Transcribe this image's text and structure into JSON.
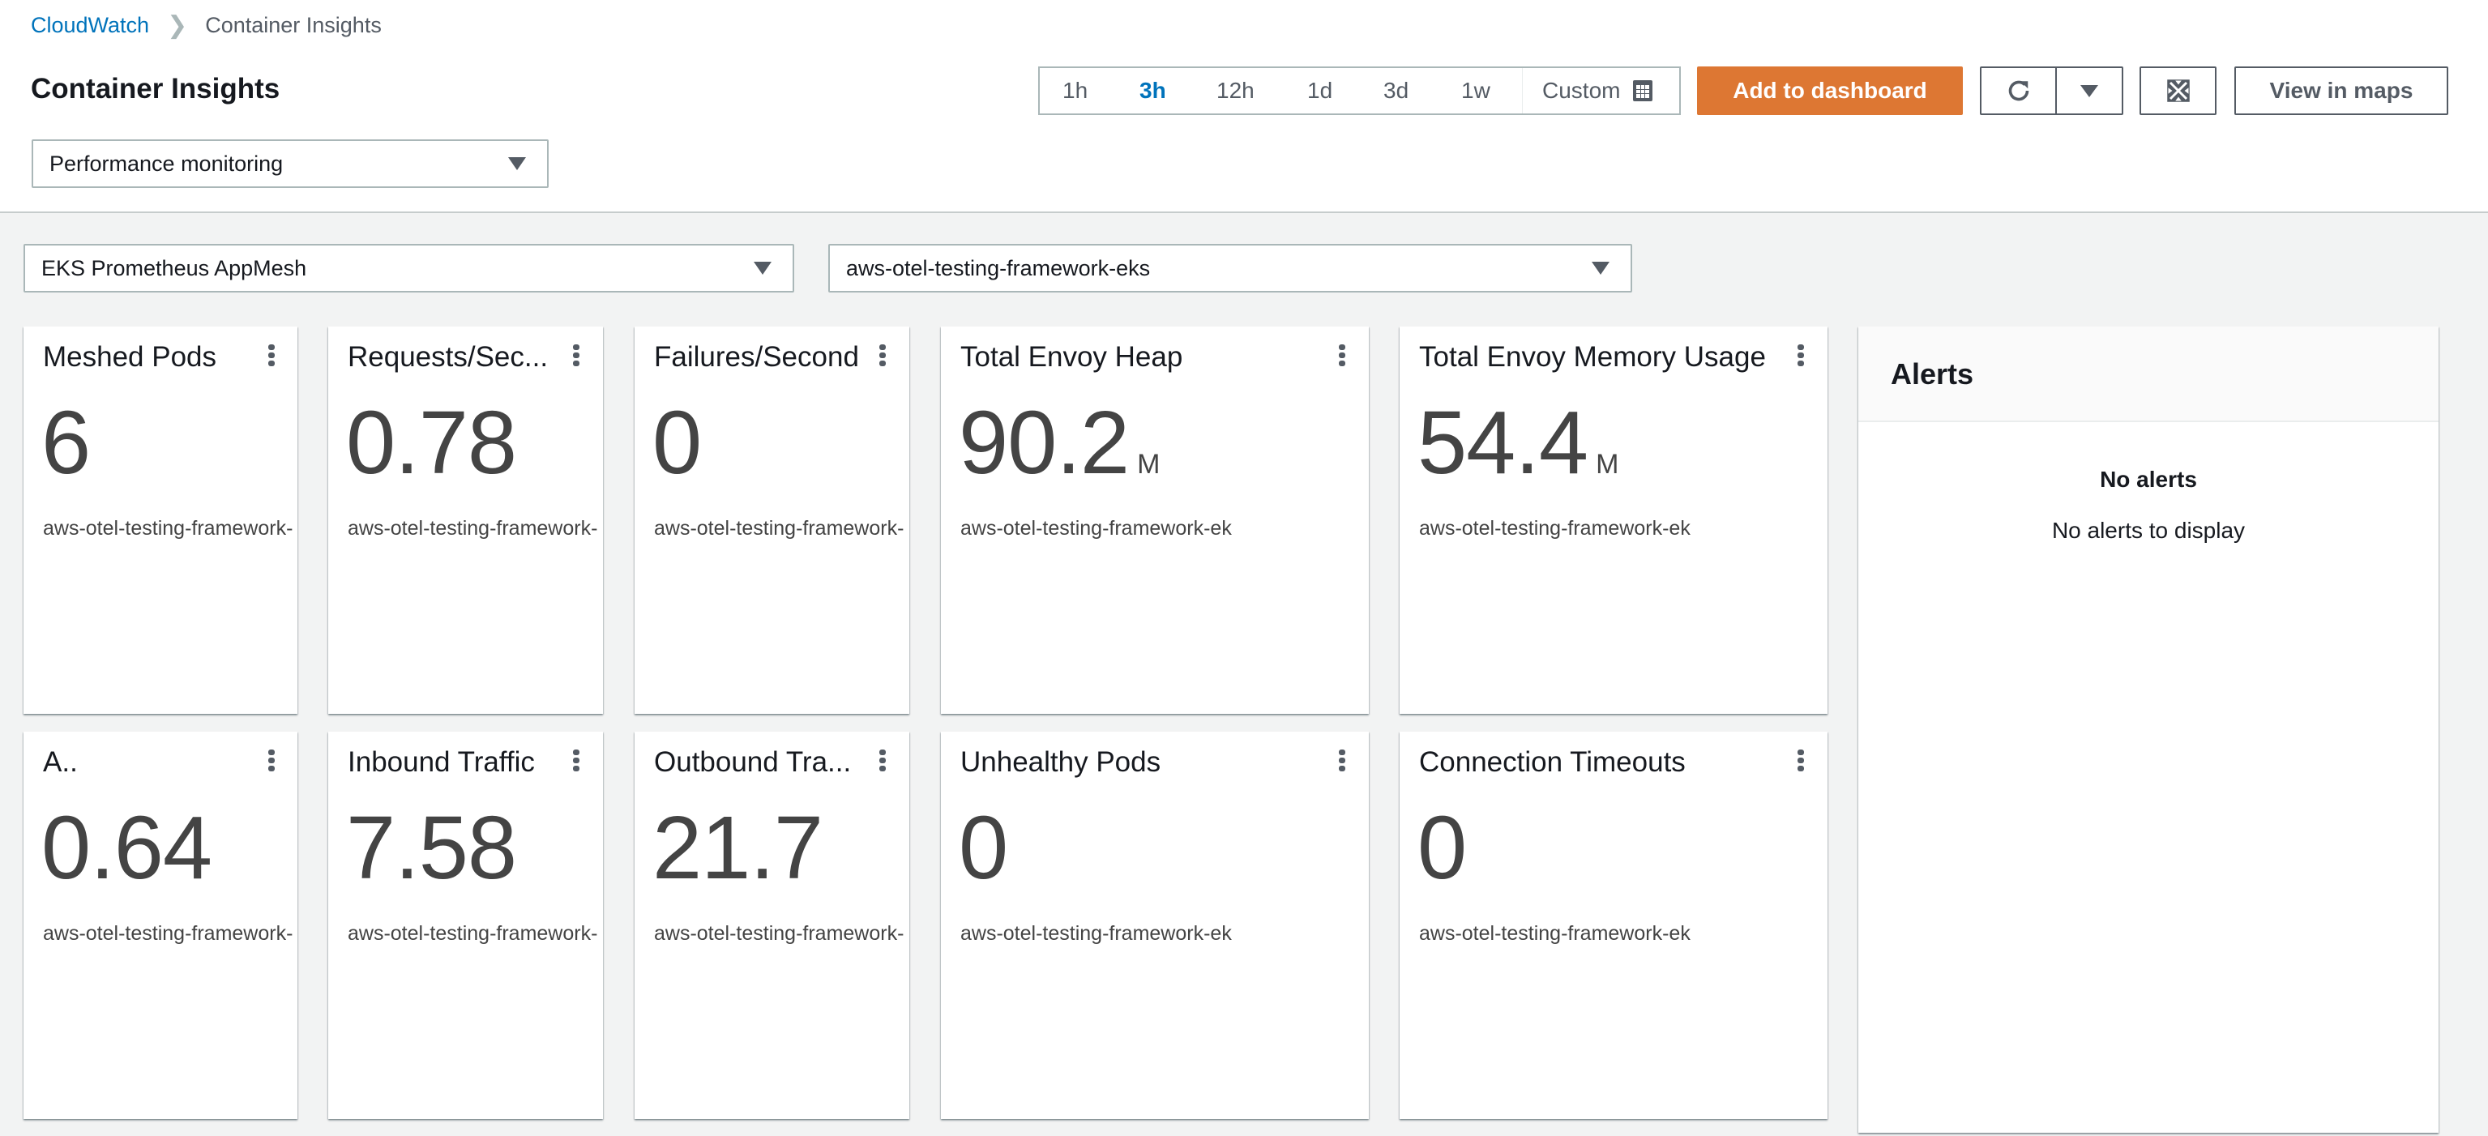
{
  "breadcrumb": {
    "items": [
      {
        "label": "CloudWatch",
        "link": true
      },
      {
        "label": "Container Insights",
        "link": false
      }
    ]
  },
  "header": {
    "title": "Container Insights",
    "view_select": {
      "value": "Performance monitoring"
    }
  },
  "time_range": {
    "options": [
      "1h",
      "3h",
      "12h",
      "1d",
      "3d",
      "1w"
    ],
    "selected": "3h",
    "custom_label": "Custom"
  },
  "toolbar": {
    "add_to_dashboard_label": "Add to dashboard",
    "refresh_icon": "refresh-icon",
    "refresh_dropdown_icon": "caret-down-icon",
    "fullscreen_icon": "fullscreen-icon",
    "view_in_maps_label": "View in maps"
  },
  "filters": {
    "resource_type": {
      "value": "EKS Prometheus AppMesh"
    },
    "cluster": {
      "value": "aws-otel-testing-framework-eks"
    }
  },
  "widgets": [
    {
      "title": "Meshed Pods",
      "value": "6",
      "unit": "",
      "subtitle": "aws-otel-testing-framework-"
    },
    {
      "title": "Requests/Sec...",
      "value": "0.78",
      "unit": "",
      "subtitle": "aws-otel-testing-framework-"
    },
    {
      "title": "Failures/Second",
      "value": "0",
      "unit": "",
      "subtitle": "aws-otel-testing-framework-"
    },
    {
      "title": "Total Envoy Heap",
      "value": "90.2",
      "unit": "M",
      "subtitle": "aws-otel-testing-framework-ek"
    },
    {
      "title": "Total Envoy Memory Usage",
      "value": "54.4",
      "unit": "M",
      "subtitle": "aws-otel-testing-framework-ek"
    },
    {
      "title": "A..",
      "value": "0.64",
      "unit": "",
      "subtitle": "aws-otel-testing-framework-"
    },
    {
      "title": "Inbound Traffic",
      "value": "7.58",
      "unit": "",
      "subtitle": "aws-otel-testing-framework-"
    },
    {
      "title": "Outbound Tra...",
      "value": "21.7",
      "unit": "",
      "subtitle": "aws-otel-testing-framework-"
    },
    {
      "title": "Unhealthy Pods",
      "value": "0",
      "unit": "",
      "subtitle": "aws-otel-testing-framework-ek"
    },
    {
      "title": "Connection Timeouts",
      "value": "0",
      "unit": "",
      "subtitle": "aws-otel-testing-framework-ek"
    }
  ],
  "alerts": {
    "title": "Alerts",
    "empty_title": "No alerts",
    "empty_text": "No alerts to display"
  },
  "colors": {
    "link": "#0073bb",
    "primary_button": "#dd7733",
    "selected_time": "#0073bb",
    "page_background": "#f2f3f3"
  }
}
